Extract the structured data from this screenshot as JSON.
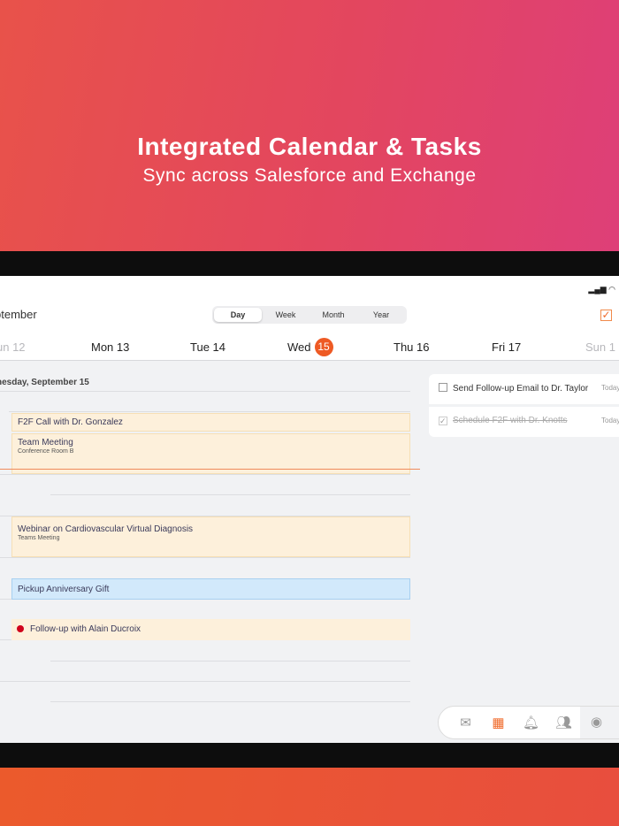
{
  "hero": {
    "title": "Integrated Calendar & Tasks",
    "subtitle": "Sync across Salesforce and Exchange"
  },
  "calendar": {
    "month_label": "ptember",
    "views": [
      "Day",
      "Week",
      "Month",
      "Year"
    ],
    "selected_view": "Day",
    "days": [
      {
        "label": "un  12",
        "dim": true
      },
      {
        "label": "Mon 13"
      },
      {
        "label": "Tue 14"
      },
      {
        "label": "Wed",
        "badge": "15"
      },
      {
        "label": "Thu 16"
      },
      {
        "label": "Fri 17"
      },
      {
        "label": "Sun  1",
        "dim": true
      }
    ],
    "date_header": "nesday, September 15",
    "events": [
      {
        "title": "F2F Call with Dr. Gonzalez"
      },
      {
        "title": "Team Meeting",
        "location": "Conference Room B"
      },
      {
        "title": "Webinar on Cardiovascular Virtual Diagnosis",
        "location": "Teams Meeting"
      },
      {
        "title": "Pickup Anniversary Gift"
      },
      {
        "title": "Follow-up with Alain Ducroix"
      }
    ]
  },
  "tasks": [
    {
      "title": "Send Follow-up Email to Dr. Taylor",
      "due": "Today",
      "done": false
    },
    {
      "title": "Schedule F2F with Dr. Knotts",
      "due": "Today",
      "done": true
    }
  ],
  "tabbar": {
    "items": [
      "mail",
      "calendar",
      "notifications",
      "contacts",
      "assistant",
      "more"
    ],
    "active": "calendar"
  },
  "colors": {
    "accent": "#ee5a24",
    "event": "#fdf0db",
    "event_blue": "#d2e9fb"
  }
}
